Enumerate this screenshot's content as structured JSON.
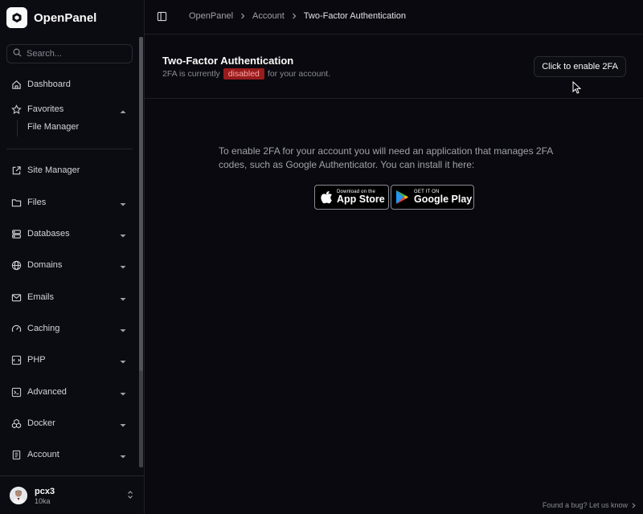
{
  "app": {
    "name": "OpenPanel"
  },
  "search": {
    "placeholder": "Search..."
  },
  "sidebar": {
    "dashboard": "Dashboard",
    "favorites": "Favorites",
    "favorites_items": [
      "File Manager"
    ],
    "items": [
      "Site Manager",
      "Files",
      "Databases",
      "Domains",
      "Emails",
      "Caching",
      "PHP",
      "Advanced",
      "Docker",
      "Account"
    ]
  },
  "user": {
    "name": "pcx3",
    "subtitle": "10ka"
  },
  "breadcrumb": [
    "OpenPanel",
    "Account",
    "Two-Factor Authentication"
  ],
  "page": {
    "title": "Two-Factor Authentication",
    "status_prefix": "2FA is currently",
    "status_badge": "disabled",
    "status_suffix": "for your account.",
    "enable_button": "Click to enable 2FA",
    "info_text": "To enable 2FA for your account you will need an application that manages 2FA codes, such as Google Authenticator. You can install it here:"
  },
  "stores": {
    "apple_small": "Download on the",
    "apple_big": "App Store",
    "google_small": "GET IT ON",
    "google_big": "Google Play"
  },
  "footer": {
    "bug_link": "Found a bug? Let us know"
  },
  "colors": {
    "background": "#09090f",
    "badge_bg": "#991b1b",
    "badge_text": "#fca5a5",
    "border": "#1f1f27"
  }
}
